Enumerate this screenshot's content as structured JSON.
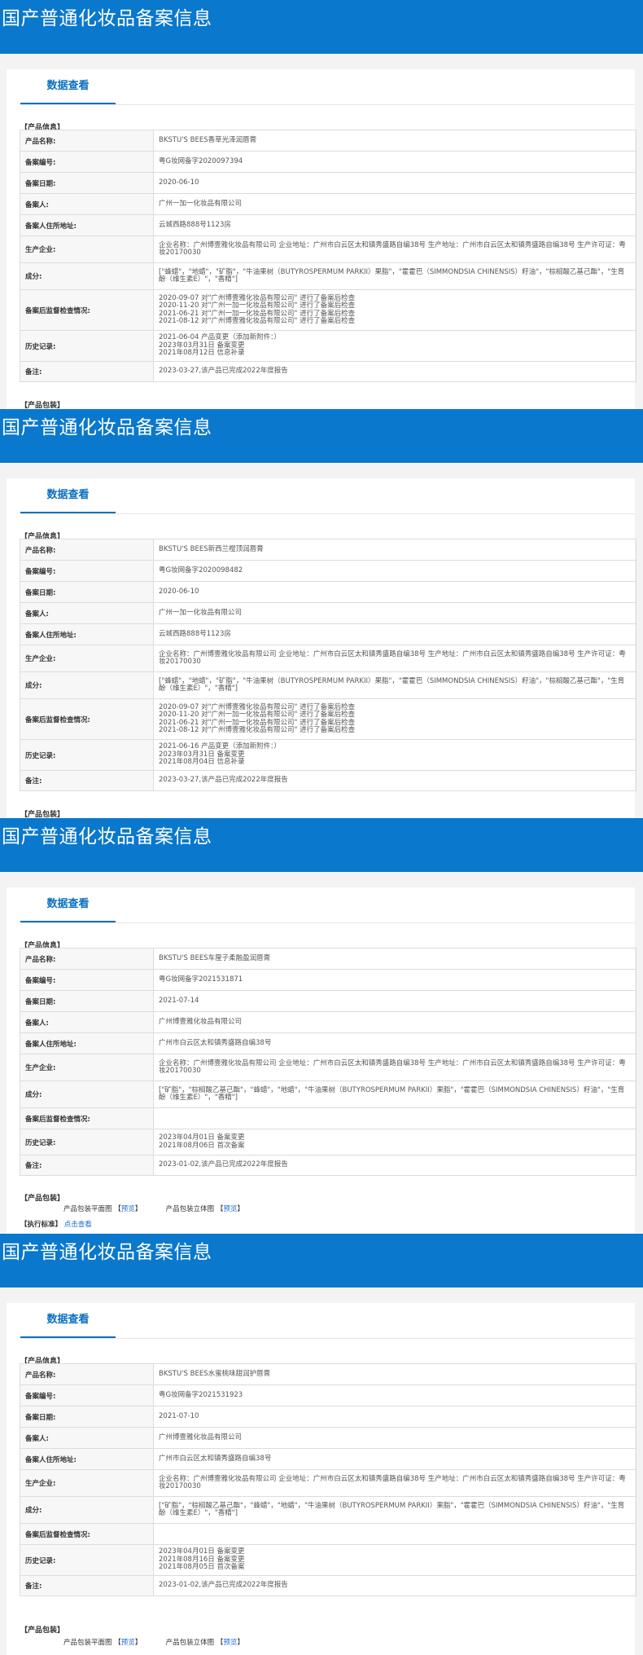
{
  "page_title": "国产普通化妆品备案信息",
  "tab_label": "数据查看",
  "section_product_info": "【产品信息】",
  "section_product_package": "【产品包装】",
  "section_exec_standard": "【执行标准】",
  "exec_standard_link": "点击查看",
  "field_labels": {
    "name": "产品名称:",
    "reg_no": "备案编号:",
    "reg_date": "备案日期:",
    "registrant": "备案人:",
    "address": "备案人住所地址:",
    "manufacturer": "生产企业:",
    "ingredients": "成分:",
    "inspection": "备案后监督检查情况:",
    "history": "历史记录:",
    "remark": "备注:"
  },
  "package_labels": {
    "flat": "产品包装平面图",
    "solid": "产品包装立体图",
    "preview": "预览",
    "bracket_open": "【",
    "bracket_close": "】"
  },
  "records": [
    {
      "name": "BKSTU'S BEES香草光泽润唇膏",
      "reg_no": "粤G妆网备字2020097394",
      "reg_date": "2020-06-10",
      "registrant": "广州一加一化妆品有限公司",
      "address": "云城西路888号1123房",
      "manufacturer": "企业名称：广州博壹雅化妆品有限公司 企业地址：广州市白云区太和镇秀盛路自编38号 生产地址：广州市白云区太和镇秀盛路自编38号 生产许可证：粤妆20170030",
      "ingredients": "[\"蜂蜡\"，\"地蜡\"，\"矿脂\"，\"牛油果树（BUTYROSPERMUM PARKII）果脂\"，\"霍霍巴（SIMMONDSIA CHINENSIS）籽油\"，\"棕榈酸乙基己酯\"，\"生育酚（维生素E）\"，\"香精\"]",
      "inspection": "2020-09-07 对\"广州博壹雅化妆品有限公司\" 进行了备案后检查\n2020-11-20 对\"广州一加一化妆品有限公司\" 进行了备案后检查\n2021-06-21 对\"广州一加一化妆品有限公司\" 进行了备案后检查\n2021-08-12 对\"广州博壹雅化妆品有限公司\" 进行了备案后检查",
      "history": "2021-06-04 产品变更（添加新附件：）\n2023年03月31日 备案变更\n2021年08月12日 信息补录",
      "remark": "2023-03-27,该产品已完成2022年度报告"
    },
    {
      "name": "BKSTU'S BEES新西兰橙顶润唇膏",
      "reg_no": "粤G妆网备字2020098482",
      "reg_date": "2020-06-10",
      "registrant": "广州一加一化妆品有限公司",
      "address": "云城西路888号1123房",
      "manufacturer": "企业名称：广州博壹雅化妆品有限公司 企业地址：广州市白云区太和镇秀盛路自编38号 生产地址：广州市白云区太和镇秀盛路自编38号 生产许可证：粤妆20170030",
      "ingredients": "[\"蜂蜡\"，\"地蜡\"，\"矿脂\"，\"牛油果树（BUTYROSPERMUM PARKII）果脂\"，\"霍霍巴（SIMMONDSIA CHINENSIS）籽油\"，\"棕榈酸乙基己酯\"，\"生育酚（维生素E）\"，\"香精\"]",
      "inspection": "2020-09-07 对\"广州博壹雅化妆品有限公司\" 进行了备案后检查\n2020-11-20 对\"广州一加一化妆品有限公司\" 进行了备案后检查\n2021-06-21 对\"广州一加一化妆品有限公司\" 进行了备案后检查\n2021-08-12 对\"广州博壹雅化妆品有限公司\" 进行了备案后检查",
      "history": "2021-06-16 产品变更（添加新附件：）\n2023年03月31日 备案变更\n2021年08月04日 信息补录",
      "remark": "2023-03-27,该产品已完成2022年度报告"
    },
    {
      "name": "BKSTU'S BEES车厘子柔融盈润唇膏",
      "reg_no": "粤G妆网备字2021531871",
      "reg_date": "2021-07-14",
      "registrant": "广州博壹雅化妆品有限公司",
      "address": "广州市白云区太和镇秀盛路自编38号",
      "manufacturer": "企业名称：广州博壹雅化妆品有限公司 企业地址：广州市白云区太和镇秀盛路自编38号 生产地址：广州市白云区太和镇秀盛路自编38号 生产许可证：粤妆20170030",
      "ingredients": "[\"矿脂\"，\"棕榈酸乙基己酯\"，\"蜂蜡\"，\"地蜡\"，\"牛油果树（BUTYROSPERMUM PARKII）果脂\"，\"霍霍巴（SIMMONDSIA CHINENSIS）籽油\"，\"生育酚（维生素E）\"，\"香精\"]",
      "inspection": "",
      "history": "2023年04月01日 备案变更\n2021年08月06日 首次备案",
      "remark": "2023-01-02,该产品已完成2022年度报告"
    },
    {
      "name": "BKSTU'S BEES水蜜桃味甜润护唇膏",
      "reg_no": "粤G妆网备字2021531923",
      "reg_date": "2021-07-10",
      "registrant": "广州博壹雅化妆品有限公司",
      "address": "广州市白云区太和镇秀盛路自编38号",
      "manufacturer": "企业名称：广州博壹雅化妆品有限公司 企业地址：广州市白云区太和镇秀盛路自编38号 生产地址：广州市白云区太和镇秀盛路自编38号 生产许可证：粤妆20170030",
      "ingredients": "[\"矿脂\"，\"棕榈酸乙基己酯\"，\"蜂蜡\"，\"地蜡\"，\"牛油果树（BUTYROSPERMUM PARKII）果脂\"，\"霍霍巴（SIMMONDSIA CHINENSIS）籽油\"，\"生育酚（维生素E）\"，\"香精\"]",
      "inspection": "",
      "history": "2023年04月01日 备案变更\n2021年08月16日 备案变更\n2021年08月05日 首次备案",
      "remark": "2023-01-02,该产品已完成2022年度报告"
    }
  ]
}
